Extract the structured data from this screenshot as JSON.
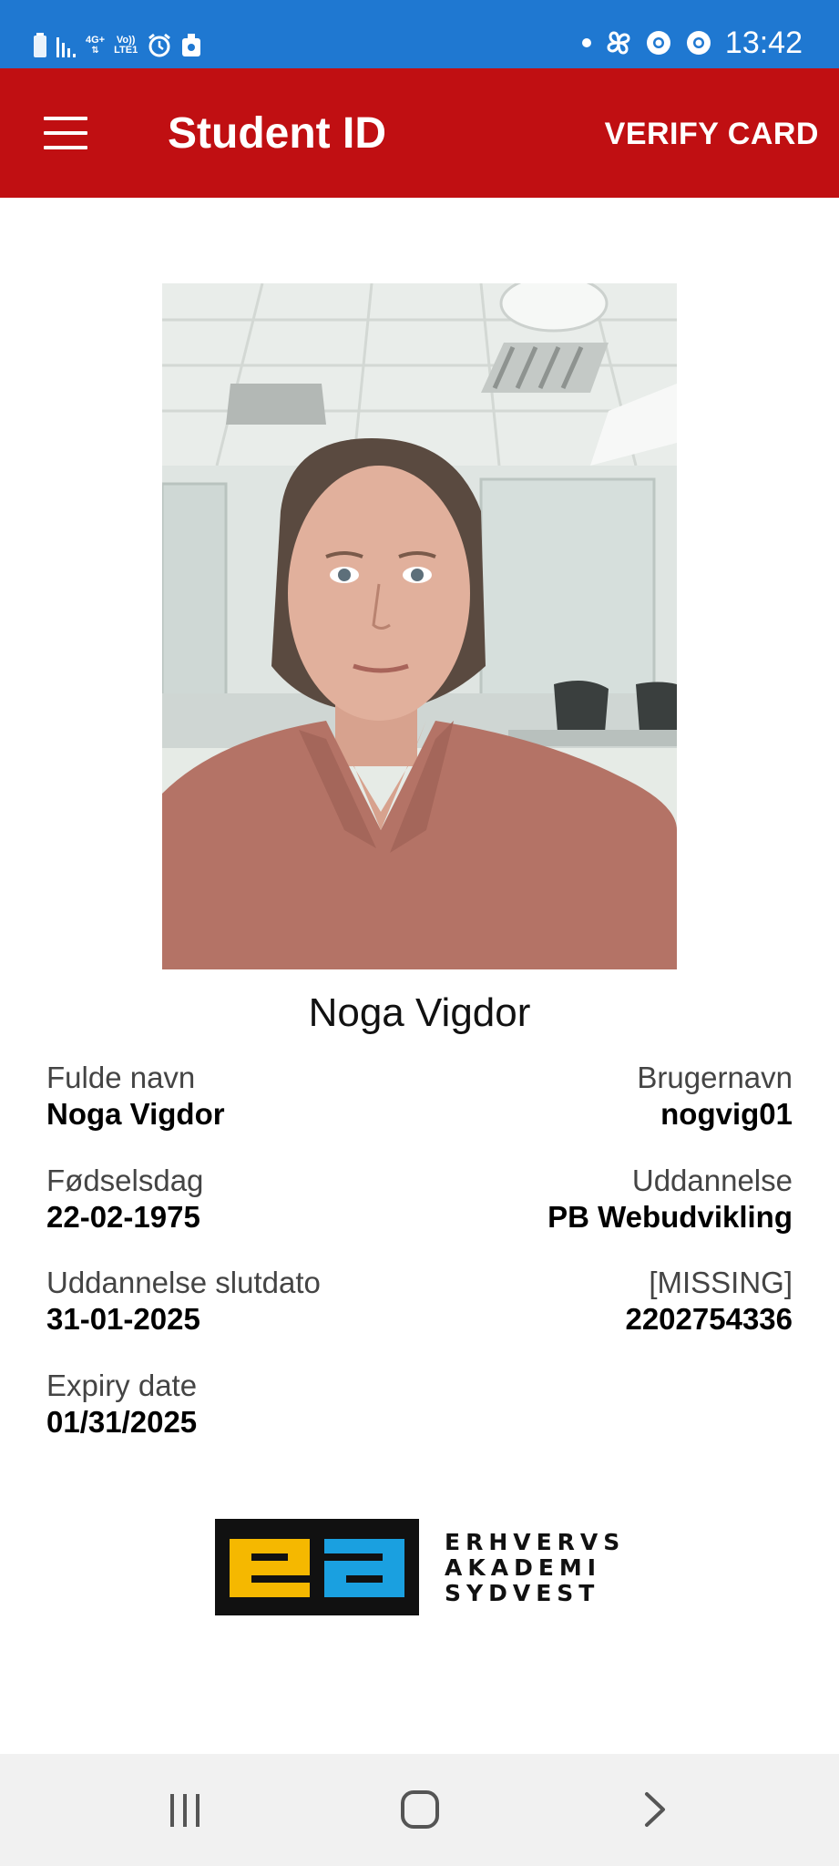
{
  "status_bar": {
    "time": "13:42",
    "network_label": "4G+",
    "volte_label": "Vo))",
    "lte_label": "LTE1",
    "icons_left": [
      "battery-icon",
      "signal-icon",
      "network-icon",
      "alarm-icon",
      "vault-icon"
    ],
    "icons_right": [
      "notification-dot-icon",
      "pinwheel-icon",
      "chrome-icon",
      "chrome-icon"
    ]
  },
  "app_bar": {
    "title": "Student ID",
    "verify_label": "VERIFY CARD",
    "background_color": "#c00f12"
  },
  "profile": {
    "display_name": "Noga Vigdor"
  },
  "fields": {
    "full_name_label": "Fulde navn",
    "full_name_value": "Noga Vigdor",
    "username_label": "Brugernavn",
    "username_value": "nogvig01",
    "birthday_label": "Fødselsdag",
    "birthday_value": "22-02-1975",
    "education_label": "Uddannelse",
    "education_value": "PB Webudvikling",
    "end_date_label": "Uddannelse slutdato",
    "end_date_value": "31-01-2025",
    "missing_label": "[MISSING]",
    "missing_value": "2202754336",
    "expiry_label": "Expiry date",
    "expiry_value": "01/31/2025"
  },
  "logo": {
    "mark_text": "ea",
    "line1": "ERHVERVS",
    "line2": "AKADEMI",
    "line3": "SYDVEST",
    "colors": {
      "yellow": "#f5b800",
      "blue": "#1aa0e0",
      "black": "#111111"
    }
  },
  "nav_bar": {
    "buttons": [
      "recent-apps-icon",
      "home-icon",
      "back-icon"
    ]
  }
}
